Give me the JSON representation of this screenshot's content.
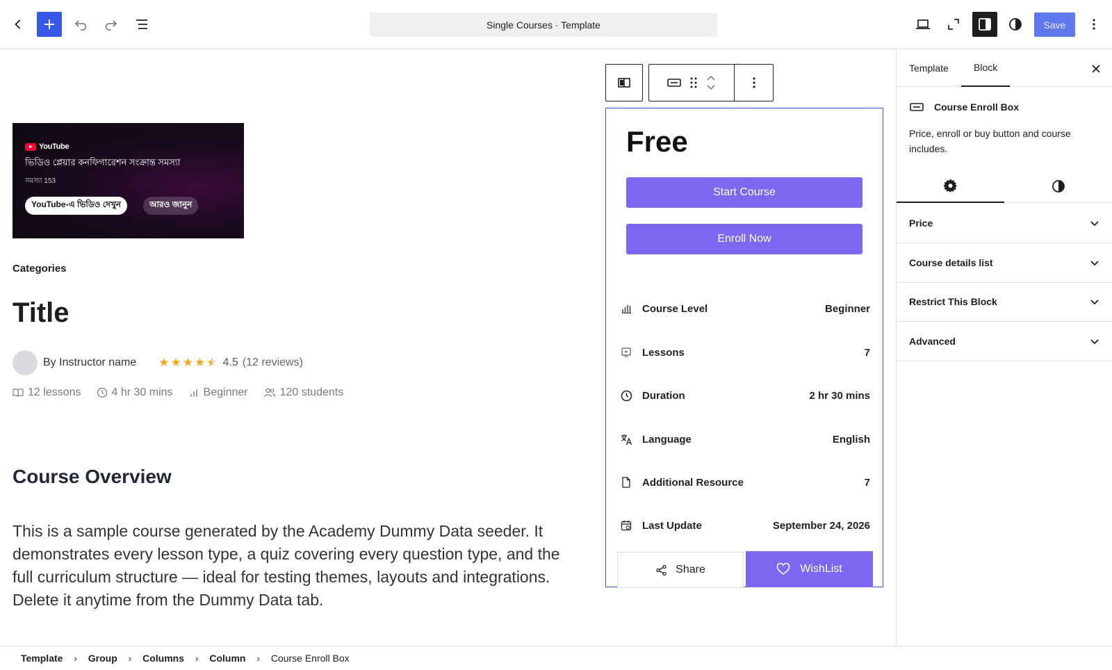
{
  "topbar": {
    "document_title": "Single Courses · Template",
    "save_label": "Save"
  },
  "canvas": {
    "video": {
      "brand": "YouTube",
      "message": "ভিডিও প্লেয়ার কনফিগারেশন সংক্রান্ত সমস্যা",
      "code": "সমস্যা 153",
      "watch_label": "YouTube-এ ভিডিও দেখুন",
      "learn_label": "আরও জানুন"
    },
    "categories": "Categories",
    "title": "Title",
    "instructor": "By Instructor name",
    "rating": "4.5",
    "rating_value": 4.5,
    "reviews": "(12 reviews)",
    "meta": {
      "lessons": "12 lessons",
      "duration": "4 hr 30 mins",
      "level": "Beginner",
      "students": "120 students"
    },
    "overview_heading": "Course Overview",
    "overview_text": "This is a sample course generated by the Academy Dummy Data seeder. It demonstrates every lesson type, a quiz covering every question type, and the full curriculum structure — ideal for testing themes, layouts and integrations. Delete it anytime from the Dummy Data tab."
  },
  "enroll_box": {
    "price": "Free",
    "start_label": "Start Course",
    "enroll_label": "Enroll Now",
    "details": [
      {
        "icon": "level-bars-icon",
        "label": "Course Level",
        "value": "Beginner"
      },
      {
        "icon": "lesson-play-icon",
        "label": "Lessons",
        "value": "7"
      },
      {
        "icon": "clock-icon",
        "label": "Duration",
        "value": "2 hr 30 mins"
      },
      {
        "icon": "translate-icon",
        "label": "Language",
        "value": "English"
      },
      {
        "icon": "file-icon",
        "label": "Additional Resource",
        "value": "7"
      },
      {
        "icon": "calendar-icon",
        "label": "Last Update",
        "value": "September 24, 2026"
      }
    ],
    "share_label": "Share",
    "wishlist_label": "WishList"
  },
  "sidebar": {
    "tabs": [
      "Template",
      "Block"
    ],
    "active_tab": "Block",
    "block_name": "Course Enroll Box",
    "block_description": "Price, enroll or buy button and course includes.",
    "panels": [
      "Price",
      "Course details list",
      "Restrict This Block",
      "Advanced"
    ]
  },
  "breadcrumb": [
    "Template",
    "Group",
    "Columns",
    "Column",
    "Course Enroll Box"
  ],
  "colors": {
    "wp_blue": "#3858e9",
    "button_purple": "#7b68ee",
    "star": "#f5a623"
  }
}
